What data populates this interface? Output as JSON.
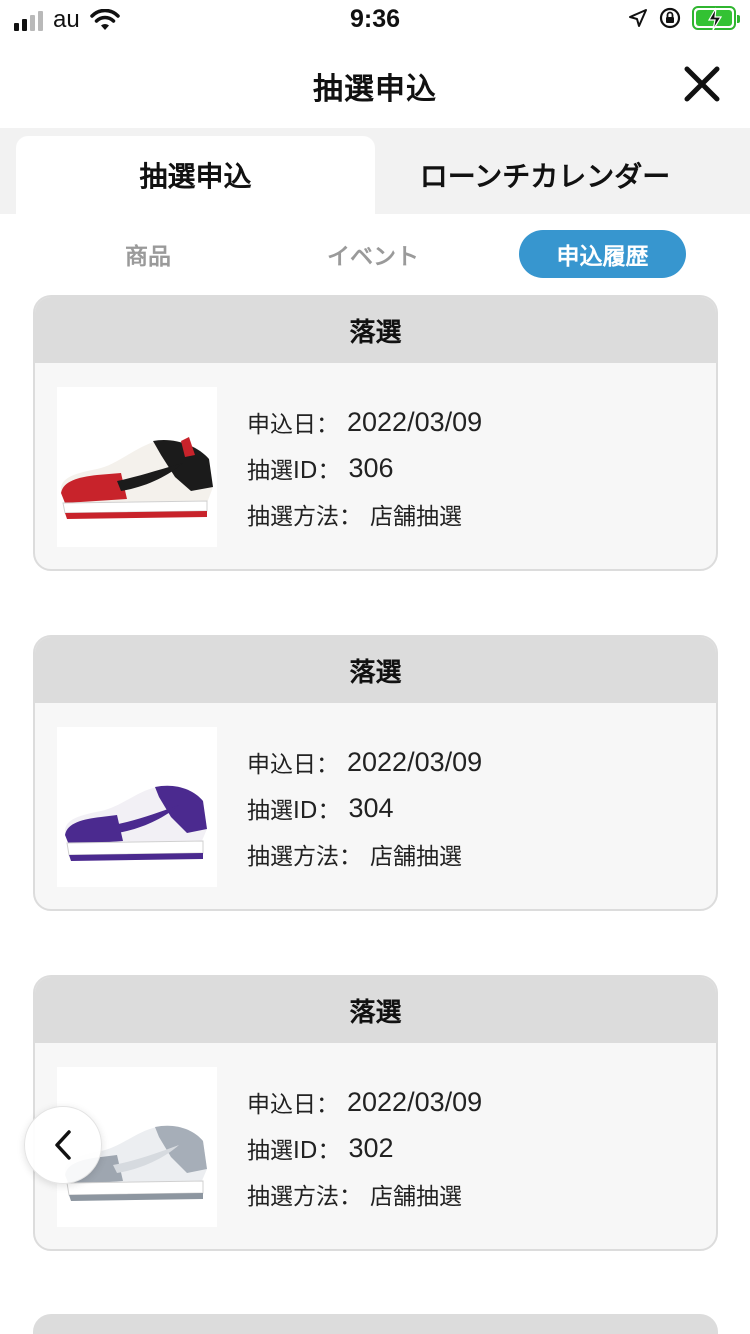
{
  "status_bar": {
    "carrier": "au",
    "time": "9:36"
  },
  "header": {
    "title": "抽選申込"
  },
  "top_tabs": [
    {
      "label": "抽選申込",
      "active": true
    },
    {
      "label": "ローンチカレンダー",
      "active": false
    }
  ],
  "sub_tabs": [
    {
      "label": "商品",
      "active": false
    },
    {
      "label": "イベント",
      "active": false
    },
    {
      "label": "申込履歴",
      "active": true
    }
  ],
  "labels": {
    "date": "申込日：",
    "id": "抽選ID：",
    "method": "抽選方法："
  },
  "entries": [
    {
      "status": "落選",
      "date": "2022/03/09",
      "id": "306",
      "method": "店舗抽選",
      "shoe_icon": "sneaker-red-black-white"
    },
    {
      "status": "落選",
      "date": "2022/03/09",
      "id": "304",
      "method": "店舗抽選",
      "shoe_icon": "sneaker-purple-white"
    },
    {
      "status": "落選",
      "date": "2022/03/09",
      "id": "302",
      "method": "店舗抽選",
      "shoe_icon": "sneaker-grey-white"
    }
  ],
  "colors": {
    "accent": "#3796cf",
    "card_header": "#dcdcdc",
    "battery": "#33c233"
  }
}
